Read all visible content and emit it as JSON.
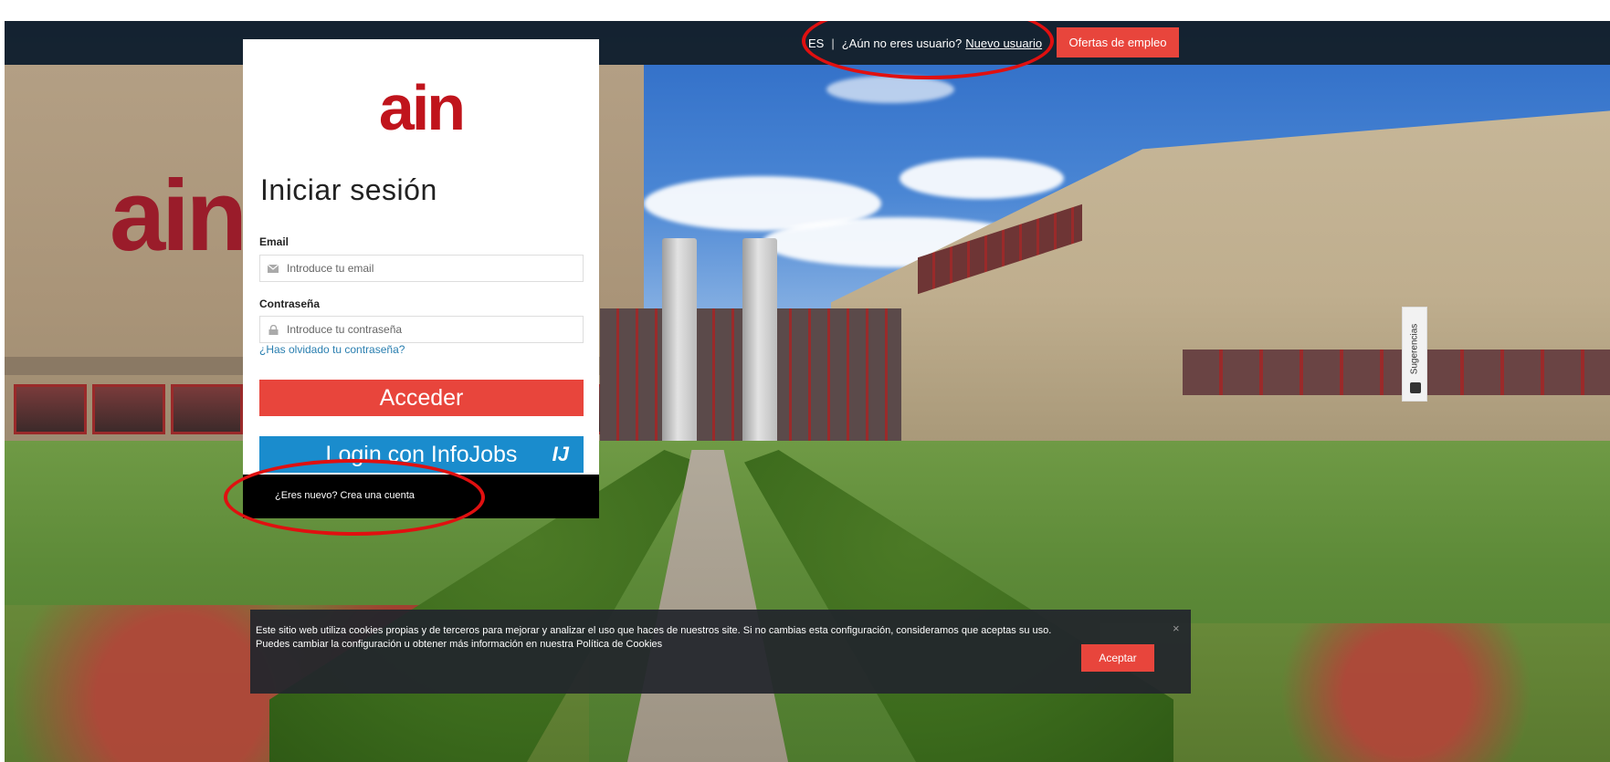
{
  "topbar": {
    "lang": "ES",
    "separator": "|",
    "question": "¿Aún no eres usuario?",
    "new_user_link": "Nuevo usuario",
    "jobs_button": "Ofertas de empleo"
  },
  "brand": {
    "logo_text": "ain",
    "background_logo_text": "ain",
    "logo_color": "#c0141c"
  },
  "login": {
    "title": "Iniciar sesión",
    "email_label": "Email",
    "email_placeholder": "Introduce tu email",
    "email_icon": "envelope-icon",
    "password_label": "Contraseña",
    "password_placeholder": "Introduce tu contraseña",
    "password_icon": "lock-icon",
    "forgot_link": "¿Has olvidado tu contraseña?",
    "submit_button": "Acceder",
    "infojobs_button": "Login con InfoJobs",
    "infojobs_badge": "IJ",
    "new_account_text": "¿Eres nuevo? Crea una cuenta"
  },
  "suggestions": {
    "label": "Sugerencias",
    "icon": "comment-icon"
  },
  "cookie_bar": {
    "message_line1": "Este sitio web utiliza cookies propias y de terceros para mejorar y analizar el uso que haces de nuestros site. Si no cambias esta configuración, consideramos que aceptas su uso.",
    "message_line2": "Puedes cambiar la configuración u obtener más información en nuestra Política de Cookies",
    "close_symbol": "×",
    "accept_button": "Aceptar"
  },
  "colors": {
    "accent_red": "#e8453c",
    "infojobs_blue": "#1a8ccd",
    "topbar": "#121c24"
  }
}
